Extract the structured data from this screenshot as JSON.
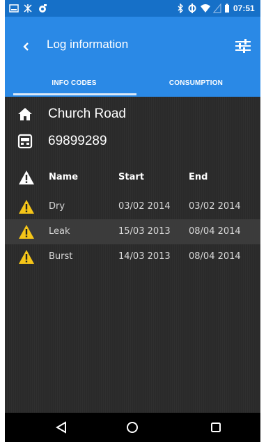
{
  "status_bar": {
    "time": "07:51",
    "icons": [
      "screenshot-icon",
      "debug-icon",
      "photo-icon",
      "bluetooth-icon",
      "sync-icon",
      "wifi-icon",
      "signal-icon",
      "battery-icon"
    ]
  },
  "app_bar": {
    "title": "Log information",
    "back_icon": "chevron-left-icon",
    "settings_icon": "sliders-icon"
  },
  "tabs": [
    {
      "label": "INFO CODES",
      "selected": true
    },
    {
      "label": "CONSUMPTION",
      "selected": false
    }
  ],
  "location": {
    "name": "Church Road",
    "meter_id": "69899289"
  },
  "table": {
    "headers": {
      "name": "Name",
      "start": "Start",
      "end": "End"
    },
    "rows": [
      {
        "name": "Dry",
        "start": "03/02 2014",
        "end": "03/02 2014"
      },
      {
        "name": "Leak",
        "start": "15/03 2013",
        "end": "08/04 2014"
      },
      {
        "name": "Burst",
        "start": "14/03 2013",
        "end": "08/04 2014"
      }
    ]
  },
  "colors": {
    "primary": "#2a89e6",
    "status_bar": "#1670c8",
    "warning": "#f5c518",
    "background": "#2a2a2a"
  },
  "nav_bar": {
    "icons": [
      "back-triangle-icon",
      "home-circle-icon",
      "recents-square-icon"
    ]
  }
}
